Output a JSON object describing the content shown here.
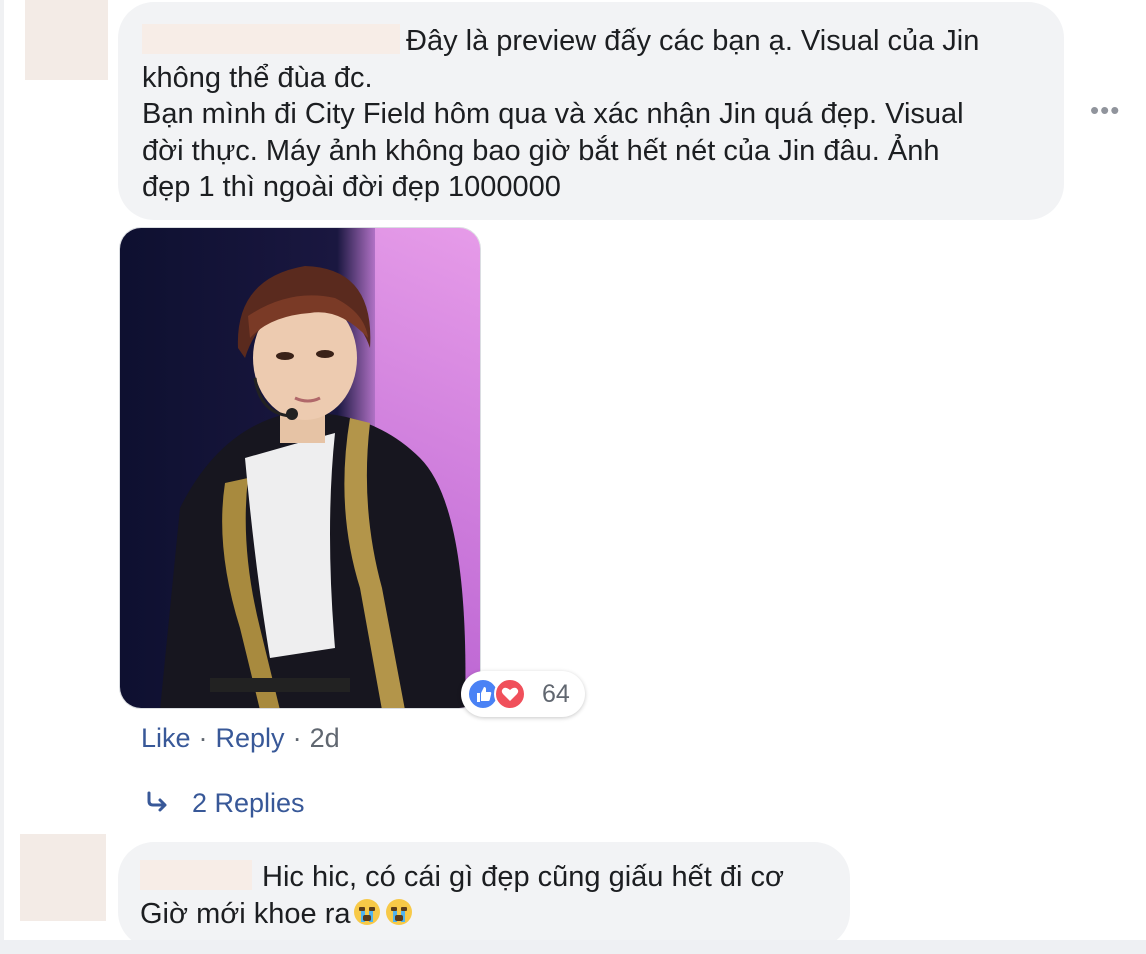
{
  "comments": [
    {
      "text_line_1": "Đây là preview đấy các bạn ạ. Visual của Jin",
      "text_line_2": "không thể đùa đc.",
      "text_line_3": "Bạn mình đi City Field hôm qua và xác nhận Jin quá đẹp. Visual",
      "text_line_4": "đời thực. Máy ảnh không bao giờ bắt hết nét của Jin đâu. Ảnh",
      "text_line_5": "đẹp 1 thì ngoài đời đẹp 1000000",
      "reaction_count": "64",
      "actions": {
        "like": "Like",
        "separator": "·",
        "reply": "Reply",
        "time": "2d"
      },
      "replies_label": "2 Replies"
    },
    {
      "text_line_1": "Hic hic, có cái gì đẹp cũng giấu hết đi cơ",
      "text_line_2": "Giờ mới khoe ra"
    }
  ],
  "icons": {
    "more": "more-options-icon",
    "like": "like-reaction-icon",
    "love": "love-reaction-icon",
    "reply_arrow": "reply-arrow-icon",
    "crying": "crying-face-emoji"
  },
  "colors": {
    "bubble": "#f2f3f5",
    "link": "#385898",
    "meta": "#606770",
    "like_reaction": "#4a82f5",
    "love_reaction": "#f0505b"
  }
}
